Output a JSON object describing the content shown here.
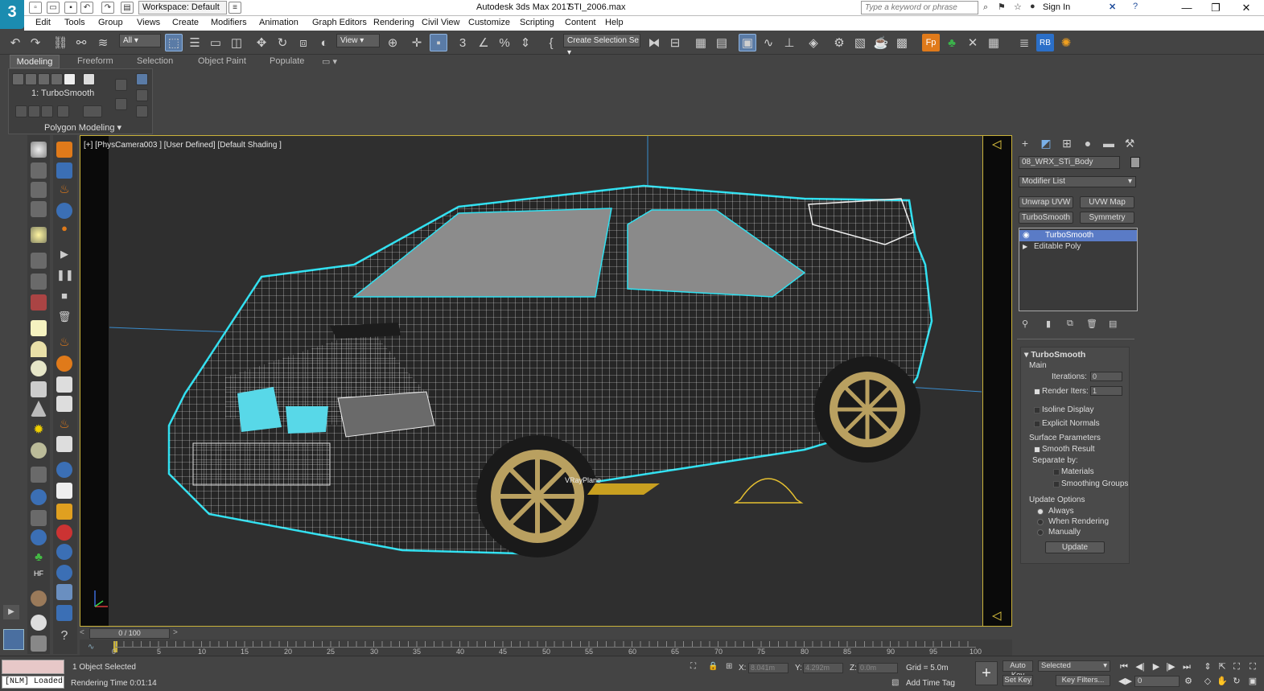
{
  "app": {
    "title": "Autodesk 3ds Max 2017",
    "file": "STI_2006.max",
    "logo": "3",
    "workspace": "Workspace: Default",
    "search_placeholder": "Type a keyword or phrase",
    "sign_in": "Sign In"
  },
  "menus": [
    "Edit",
    "Tools",
    "Group",
    "Views",
    "Create",
    "Modifiers",
    "Animation",
    "Graph Editors",
    "Rendering",
    "Civil View",
    "Customize",
    "Scripting",
    "Content",
    "Help"
  ],
  "toolbar": {
    "selection_filter": "All",
    "ref_coord": "View",
    "named_selection": "Create Selection Se"
  },
  "ribbon": {
    "tabs": [
      "Modeling",
      "Freeform",
      "Selection",
      "Object Paint",
      "Populate"
    ],
    "modifier_label": "1: TurboSmooth",
    "panel_label": "Polygon Modeling"
  },
  "viewport": {
    "label": "[+] [PhysCamera003 ] [User Defined] [Default Shading ]",
    "object_label": "VRayPlane"
  },
  "command_panel": {
    "object_name": "08_WRX_STi_Body",
    "modifier_list": "Modifier List",
    "modifier_buttons": [
      "Unwrap UVW",
      "UVW Map",
      "TurboSmooth",
      "Symmetry"
    ],
    "stack": [
      "TurboSmooth",
      "Editable Poly"
    ],
    "rollout": {
      "title": "TurboSmooth",
      "main": "Main",
      "iterations_label": "Iterations:",
      "iterations_value": "0",
      "render_iters_label": "Render Iters:",
      "render_iters_value": "1",
      "isoline": "Isoline Display",
      "explicit_normals": "Explicit Normals",
      "surface_params": "Surface Parameters",
      "smooth_result": "Smooth Result",
      "separate_by": "Separate by:",
      "materials": "Materials",
      "smoothing_groups": "Smoothing Groups",
      "update_options": "Update Options",
      "always": "Always",
      "when_rendering": "When Rendering",
      "manually": "Manually",
      "update_button": "Update"
    }
  },
  "timeline": {
    "frame_display": "0 / 100",
    "ticks": [
      "0",
      "5",
      "10",
      "15",
      "20",
      "25",
      "30",
      "35",
      "40",
      "45",
      "50",
      "55",
      "60",
      "65",
      "70",
      "75",
      "80",
      "85",
      "90",
      "95",
      "100"
    ]
  },
  "status": {
    "selected": "1 Object Selected",
    "render_time": "Rendering Time  0:01:14",
    "nlm": "[NLM] Loaded",
    "x_label": "X:",
    "x_value": "8.041m",
    "y_label": "Y:",
    "y_value": "4.292m",
    "z_label": "Z:",
    "z_value": "0.0m",
    "grid": "Grid = 5.0m",
    "add_time_tag": "Add Time Tag",
    "auto_key": "Auto Key",
    "set_key": "Set Key",
    "key_mode": "Selected",
    "key_filters": "Key Filters...",
    "frame": "0"
  },
  "colors": {
    "accent": "#c9b23a",
    "selection": "#5a7ba6",
    "wire_outline": "#30e0f0",
    "wheel": "#b9a060"
  }
}
